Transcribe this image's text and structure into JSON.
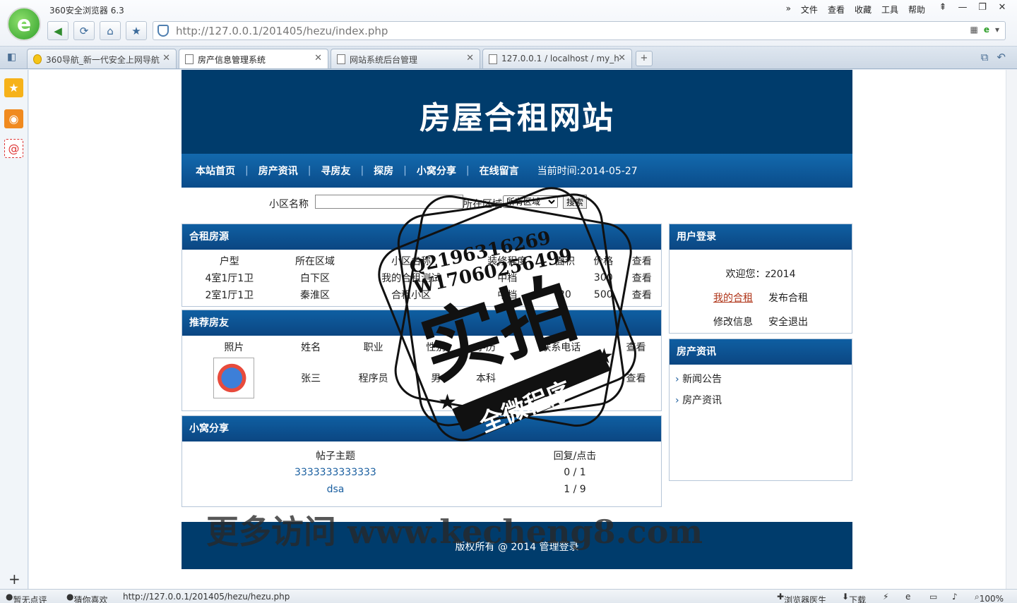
{
  "browser": {
    "app_title": "360安全浏览器 6.3",
    "menu": [
      "文件",
      "查看",
      "收藏",
      "工具",
      "帮助"
    ],
    "url_host": "http://127.0.0.1/201405/hezu/index.php",
    "tabs": [
      {
        "label": "360导航_新一代安全上网导航"
      },
      {
        "label": "房产信息管理系统"
      },
      {
        "label": "网站系统后台管理"
      },
      {
        "label": "127.0.0.1 / localhost / my_h"
      }
    ]
  },
  "site": {
    "banner_title": "房屋合租网站",
    "nav": {
      "items": [
        "本站首页",
        "房产资讯",
        "寻房友",
        "探房",
        "小窝分享",
        "在线留言"
      ],
      "time_label": "当前时间:2014-05-27"
    },
    "search": {
      "community_label": "小区名称",
      "area_label": "所在区域",
      "area_value": "所有区域",
      "button_label": "搜索"
    },
    "listings": {
      "title": "合租房源",
      "headers": [
        "户型",
        "所在区域",
        "小区名称",
        "装修程度",
        "面积",
        "价格",
        "查看"
      ],
      "rows": [
        [
          "4室1厅1卫",
          "白下区",
          "我的合租测试",
          "中档",
          "",
          "300",
          "查看"
        ],
        [
          "2室1厅1卫",
          "秦淮区",
          "合租小区",
          "中档",
          "20",
          "500",
          "查看"
        ]
      ]
    },
    "roommates": {
      "title": "推荐房友",
      "headers": [
        "照片",
        "姓名",
        "职业",
        "性别",
        "学历",
        "",
        "联系电话",
        "查看"
      ],
      "rows": [
        [
          "",
          "张三",
          "程序员",
          "男",
          "本科",
          "",
          "",
          "查看"
        ]
      ]
    },
    "share": {
      "title": "小窝分享",
      "headers": [
        "帖子主题",
        "回复/点击"
      ],
      "rows": [
        [
          "3333333333333",
          "0 / 1"
        ],
        [
          "dsa",
          "1 / 9"
        ]
      ]
    },
    "login": {
      "title": "用户登录",
      "welcome": "欢迎您：z2014",
      "my_rent": "我的合租",
      "publish": "发布合租",
      "edit": "修改信息",
      "logout": "安全退出"
    },
    "news": {
      "title": "房产资讯",
      "links": [
        "新闻公告",
        "房产资讯"
      ]
    },
    "footer": "版权所有 @ 2014 管理登录"
  },
  "watermark": {
    "line1": "Q2196316269",
    "line2": "W17060256499",
    "big": "实拍",
    "ribbon": "全微程序",
    "bottom": "更多访问 www.kecheng8.com"
  },
  "status": {
    "review": "暂无点评",
    "guess": "猜你喜欢",
    "link_url": "http://127.0.0.1/201405/hezu/hezu.php",
    "doctor": "浏览器医生",
    "download": "下载",
    "zoom": "100%"
  }
}
